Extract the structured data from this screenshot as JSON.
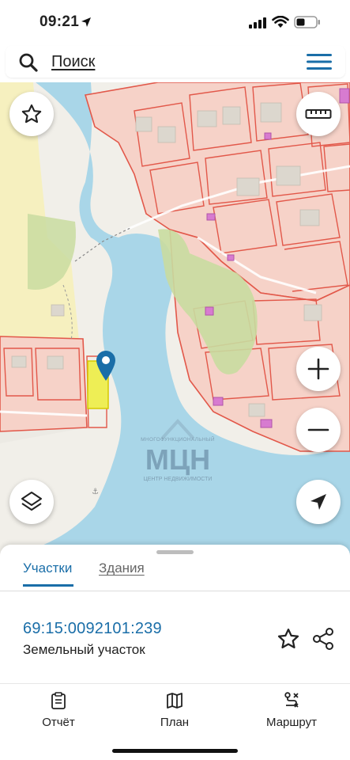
{
  "status": {
    "time": "09:21"
  },
  "search": {
    "placeholder": "Поиск"
  },
  "map": {
    "watermark": {
      "small_text": "МНОГОФУНКЦИОНАЛЬНЫЙ",
      "logo_text": "МЦН",
      "subtitle": "ЦЕНТР НЕДВИЖИМОСТИ"
    },
    "colors": {
      "water": "#a9d6e8",
      "land": "#f1efe9",
      "plot_fill": "#f6d2c8",
      "plot_border": "#e2584a",
      "forest": "#c9dca0",
      "selected": "#eeee55",
      "marker": "#1a6ea8"
    }
  },
  "sheet": {
    "tabs": [
      {
        "label": "Участки",
        "active": true
      },
      {
        "label": "Здания",
        "active": false
      }
    ],
    "parcel": {
      "cadastral_number": "69:15:0092101:239",
      "type": "Земельный участок"
    }
  },
  "bottom_nav": [
    {
      "label": "Отчёт",
      "icon": "report-icon"
    },
    {
      "label": "План",
      "icon": "map-plan-icon"
    },
    {
      "label": "Маршрут",
      "icon": "route-icon"
    }
  ],
  "accent_color": "#1a6ea8"
}
